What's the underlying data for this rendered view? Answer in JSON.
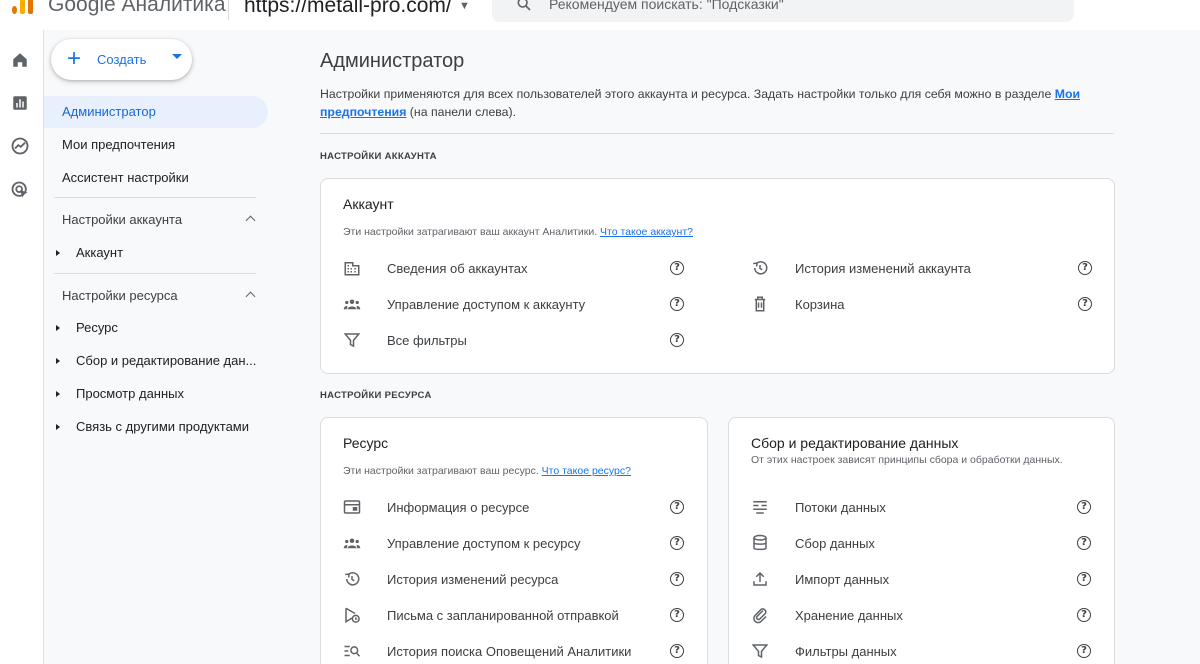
{
  "header": {
    "app_name": "Google Аналитика",
    "property_url": "https://metall-pro.com/",
    "search_placeholder": "Рекомендуем поискать: \"Подсказки\""
  },
  "rail": {
    "icons": [
      "home-icon",
      "reports-icon",
      "explore-icon",
      "advertising-icon"
    ]
  },
  "sidebar": {
    "create_label": "Создать",
    "items": [
      {
        "label": "Администратор",
        "active": true
      },
      {
        "label": "Мои предпочтения"
      },
      {
        "label": "Ассистент настройки"
      }
    ],
    "account_section": {
      "title": "Настройки аккаунта",
      "items": [
        {
          "label": "Аккаунт"
        }
      ]
    },
    "property_section": {
      "title": "Настройки ресурса",
      "items": [
        {
          "label": "Ресурс"
        },
        {
          "label": "Сбор и редактирование дан..."
        },
        {
          "label": "Просмотр данных"
        },
        {
          "label": "Связь с другими продуктами"
        }
      ]
    }
  },
  "main": {
    "title": "Администратор",
    "intro_text": "Настройки применяются для всех пользователей этого аккаунта и ресурса. Задать настройки только для себя можно в разделе ",
    "intro_link": "Мои предпочтения",
    "intro_tail": " (на панели слева).",
    "account_settings_label": "НАСТРОЙКИ АККАУНТА",
    "account_card": {
      "title": "Аккаунт",
      "subtitle": "Эти настройки затрагивают ваш аккаунт Аналитики. ",
      "subtitle_link": "Что такое аккаунт?",
      "left_rows": [
        {
          "label": "Сведения об аккаунтах",
          "icon": "building-icon"
        },
        {
          "label": "Управление доступом к аккаунту",
          "icon": "group-icon"
        },
        {
          "label": "Все фильтры",
          "icon": "filter-icon"
        }
      ],
      "right_rows": [
        {
          "label": "История изменений аккаунта",
          "icon": "history-icon"
        },
        {
          "label": "Корзина",
          "icon": "trash-icon"
        }
      ]
    },
    "property_settings_label": "НАСТРОЙКИ РЕСУРСА",
    "property_card": {
      "title": "Ресурс",
      "subtitle": "Эти настройки затрагивают ваш ресурс. ",
      "subtitle_link": "Что такое ресурс?",
      "rows": [
        {
          "label": "Информация о ресурсе",
          "icon": "property-icon"
        },
        {
          "label": "Управление доступом к ресурсу",
          "icon": "group-icon"
        },
        {
          "label": "История изменений ресурса",
          "icon": "history-icon"
        },
        {
          "label": "Письма с запланированной отправкой",
          "icon": "scheduled-email-icon"
        },
        {
          "label": "История поиска Оповещений Аналитики",
          "icon": "search-history-icon"
        }
      ]
    },
    "data_card": {
      "title": "Сбор и редактирование данных",
      "subtitle": "От этих настроек зависят принципы сбора и обработки данных.",
      "rows": [
        {
          "label": "Потоки данных",
          "icon": "streams-icon"
        },
        {
          "label": "Сбор данных",
          "icon": "database-icon"
        },
        {
          "label": "Импорт данных",
          "icon": "upload-icon"
        },
        {
          "label": "Хранение данных",
          "icon": "retention-icon"
        },
        {
          "label": "Фильтры данных",
          "icon": "filter-icon"
        }
      ]
    }
  }
}
